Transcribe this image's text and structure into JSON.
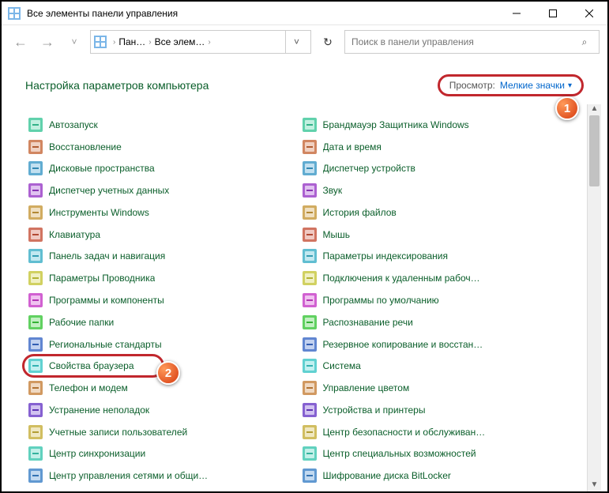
{
  "window": {
    "title": "Все элементы панели управления"
  },
  "nav": {
    "bc1": "Пан…",
    "bc2": "Все элем…",
    "search_placeholder": "Поиск в панели управления"
  },
  "heading": {
    "title": "Настройка параметров компьютера",
    "view_label": "Просмотр:",
    "view_value": "Мелкие значки"
  },
  "badges": {
    "b1": "1",
    "b2": "2"
  },
  "col1": [
    "Автозапуск",
    "Восстановление",
    "Дисковые пространства",
    "Диспетчер учетных данных",
    "Инструменты Windows",
    "Клавиатура",
    "Панель задач и навигация",
    "Параметры Проводника",
    "Программы и компоненты",
    "Рабочие папки",
    "Региональные стандарты",
    "Свойства браузера",
    "Телефон и модем",
    "Устранение неполадок",
    "Учетные записи пользователей",
    "Центр синхронизации",
    "Центр управления сетями и общи…"
  ],
  "col2": [
    "Брандмауэр Защитника Windows",
    "Дата и время",
    "Диспетчер устройств",
    "Звук",
    "История файлов",
    "Мышь",
    "Параметры индексирования",
    "Подключения к удаленным рабоч…",
    "Программы по умолчанию",
    "Распознавание речи",
    "Резервное копирование и восстан…",
    "Система",
    "Управление цветом",
    "Устройства и принтеры",
    "Центр безопасности и обслуживан…",
    "Центр специальных возможностей",
    "Шифрование диска BitLocker"
  ]
}
